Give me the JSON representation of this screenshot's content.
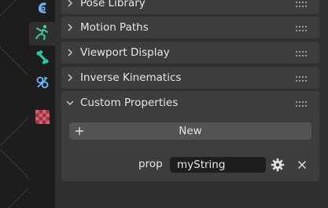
{
  "colors": {
    "tab_posebone_accent": "#44c8a0",
    "tab_bone_accent": "#2ec4a6",
    "tab_constraint_accent": "#6db6ff",
    "tab_texture_accent": "#e05a6a"
  },
  "tabs": [
    {
      "icon": "object-data-icon"
    },
    {
      "icon": "armature-pose-icon",
      "active": true
    },
    {
      "icon": "bone-icon"
    },
    {
      "icon": "bone-constraint-icon"
    },
    {
      "icon": "texture-icon"
    }
  ],
  "panels": {
    "pose_library": {
      "label": "Pose Library"
    },
    "motion_paths": {
      "label": "Motion Paths"
    },
    "viewport_display": {
      "label": "Viewport Display"
    },
    "inverse_kinematics": {
      "label": "Inverse Kinematics"
    },
    "custom_properties": {
      "label": "Custom Properties",
      "new_label": "New",
      "property": {
        "name": "prop",
        "value": "myString"
      }
    }
  }
}
